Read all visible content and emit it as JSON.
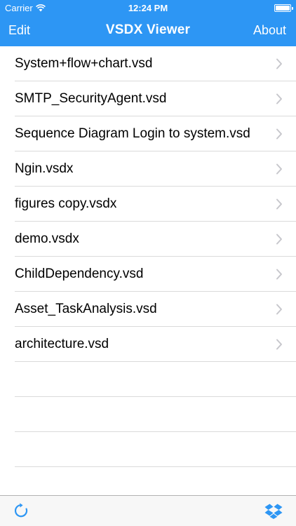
{
  "status_bar": {
    "carrier": "Carrier",
    "time": "12:24 PM"
  },
  "nav_bar": {
    "left_button": "Edit",
    "title": "VSDX Viewer",
    "right_button": "About"
  },
  "files": [
    "System+flow+chart.vsd",
    "SMTP_SecurityAgent.vsd",
    "Sequence Diagram Login to system.vsd",
    "Ngin.vsdx",
    "figures copy.vsdx",
    "demo.vsdx",
    "ChildDependency.vsd",
    "Asset_TaskAnalysis.vsd",
    "architecture.vsd"
  ],
  "toolbar": {
    "left_icon": "refresh-icon",
    "right_icon": "dropbox-icon"
  },
  "colors": {
    "accent": "#2d96f4",
    "separator": "#dadada",
    "chevron": "#c7c7cc"
  }
}
